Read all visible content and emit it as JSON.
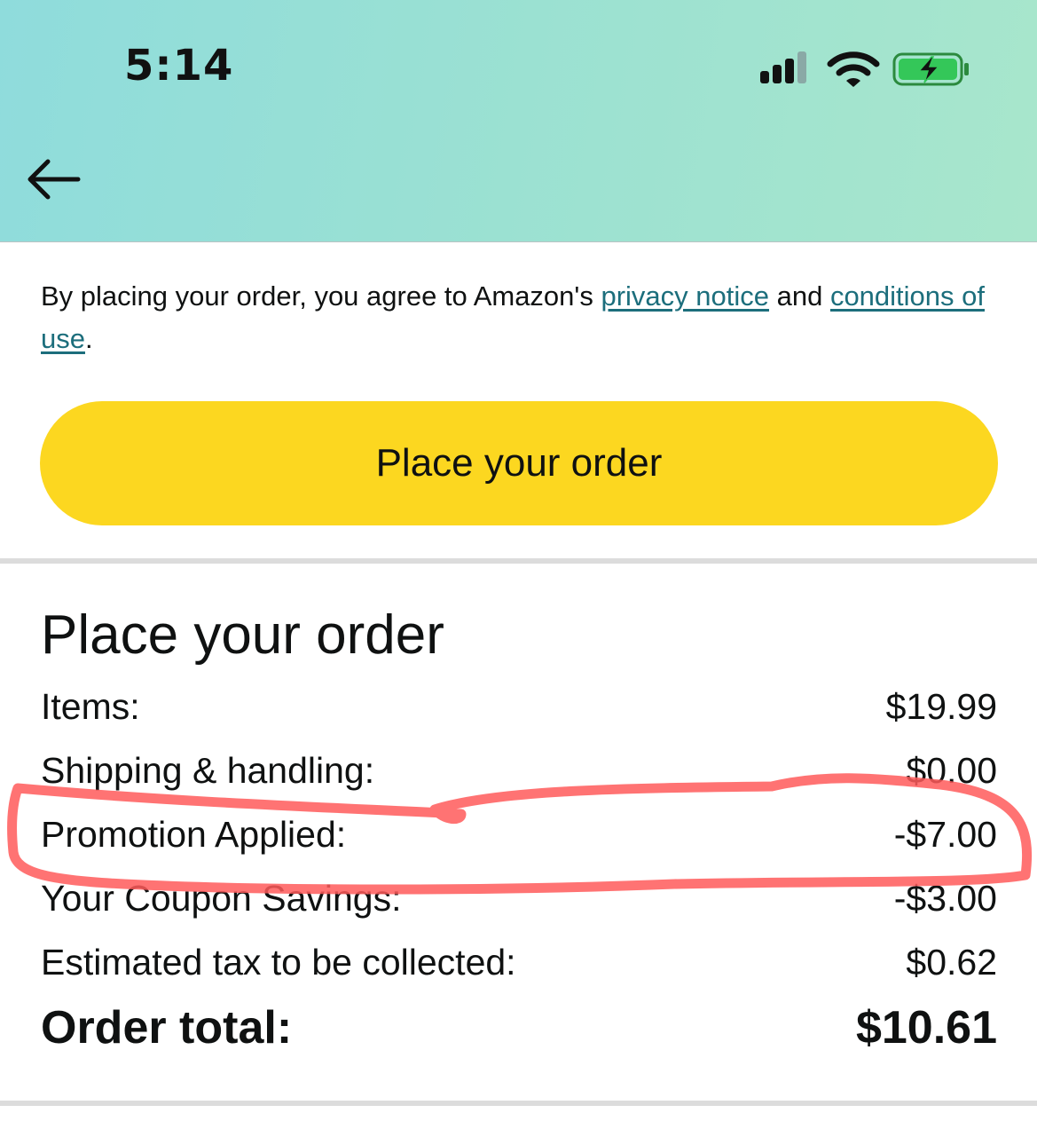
{
  "status_bar": {
    "time": "5:14",
    "icons": [
      "signal-icon",
      "wifi-icon",
      "battery-charging-icon"
    ],
    "battery_color": "#34c759"
  },
  "nav": {
    "back_icon": "arrow-left-icon"
  },
  "agreement": {
    "prefix": "By placing your order, you agree to Amazon's ",
    "privacy_link": "privacy notice",
    "middle": " and ",
    "conditions_link": "conditions of use",
    "suffix": ".",
    "link_color": "#1c6e7c"
  },
  "place_order_button": {
    "label": "Place your order",
    "color": "#fcd720"
  },
  "order_summary": {
    "title": "Place your order",
    "rows": [
      {
        "label": "Items:",
        "value": "$19.99"
      },
      {
        "label": "Shipping & handling:",
        "value": "$0.00"
      },
      {
        "label": "Promotion Applied:",
        "value": "-$7.00"
      },
      {
        "label": "Your Coupon Savings:",
        "value": "-$3.00"
      },
      {
        "label": "Estimated tax to be collected:",
        "value": "$0.62"
      }
    ],
    "total": {
      "label": "Order total:",
      "value": "$10.61"
    }
  },
  "annotation": {
    "highlight_color": "#ff5a5a"
  }
}
